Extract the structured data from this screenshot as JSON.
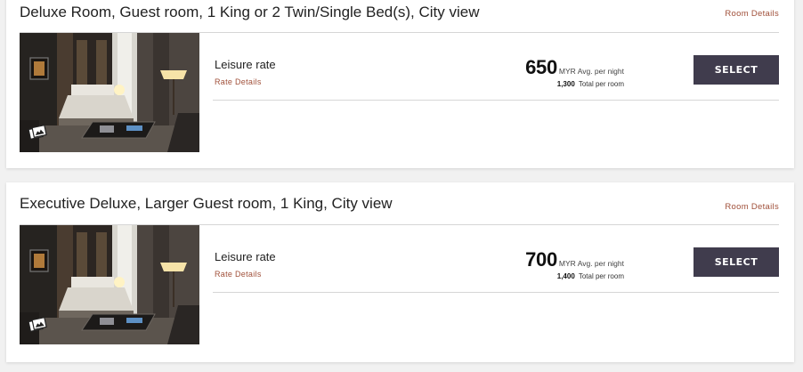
{
  "colors": {
    "link": "#a0503a",
    "select_button_bg": "#403c4d",
    "select_button_text": "#ffffff"
  },
  "rooms": [
    {
      "title": "Deluxe Room, Guest room, 1 King or 2 Twin/Single Bed(s), City view",
      "room_details_label": "Room Details",
      "photo_icon": "gallery-icon",
      "rates": [
        {
          "name": "Leisure rate",
          "details_label": "Rate Details",
          "avg_price": "650",
          "avg_unit": "MYR Avg. per night",
          "total_price": "1,300",
          "total_unit": "Total per room",
          "select_label": "SELECT"
        }
      ]
    },
    {
      "title": "Executive Deluxe, Larger Guest room, 1 King, City view",
      "room_details_label": "Room Details",
      "photo_icon": "gallery-icon",
      "rates": [
        {
          "name": "Leisure rate",
          "details_label": "Rate Details",
          "avg_price": "700",
          "avg_unit": "MYR Avg. per night",
          "total_price": "1,400",
          "total_unit": "Total per room",
          "select_label": "SELECT"
        }
      ]
    }
  ]
}
